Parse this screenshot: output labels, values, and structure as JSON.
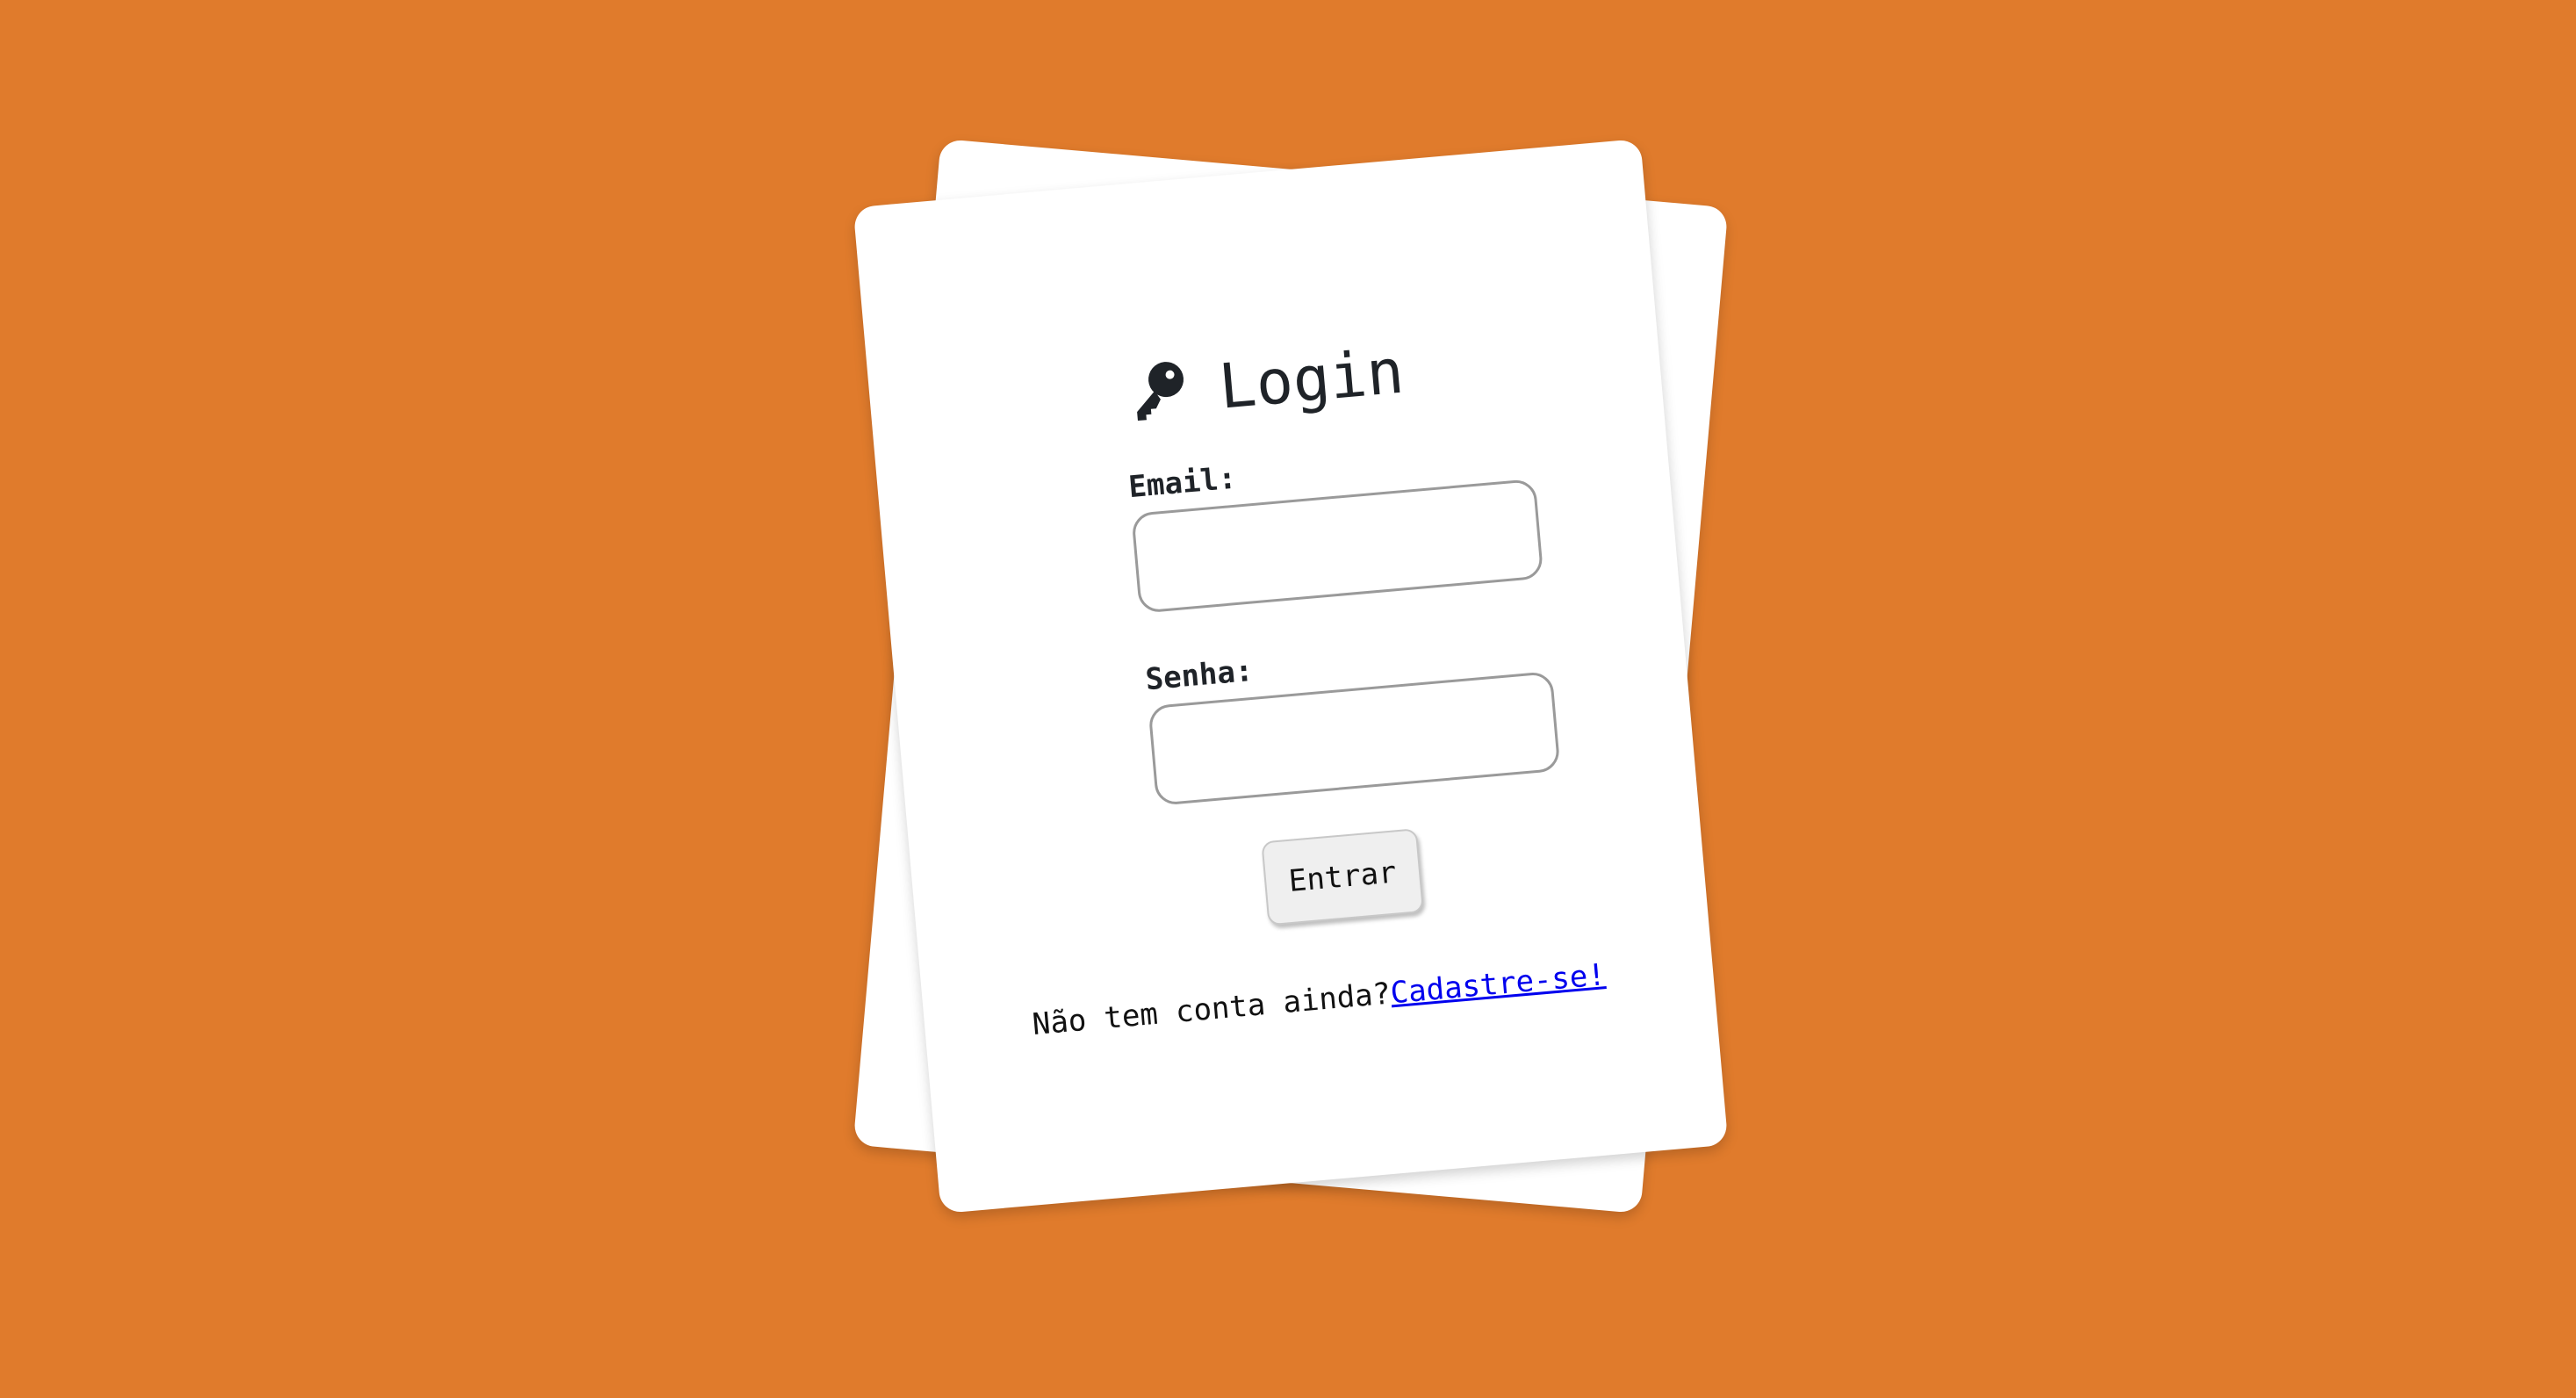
{
  "colors": {
    "background": "#e07b2c",
    "card": "#ffffff",
    "link": "#0000ee"
  },
  "login": {
    "icon": "key-icon",
    "title": "Login",
    "email_label": "Email:",
    "email_value": "",
    "password_label": "Senha:",
    "password_value": "",
    "submit_label": "Entrar",
    "signup_prompt": "Não tem conta ainda?",
    "signup_link": "Cadastre-se!"
  }
}
